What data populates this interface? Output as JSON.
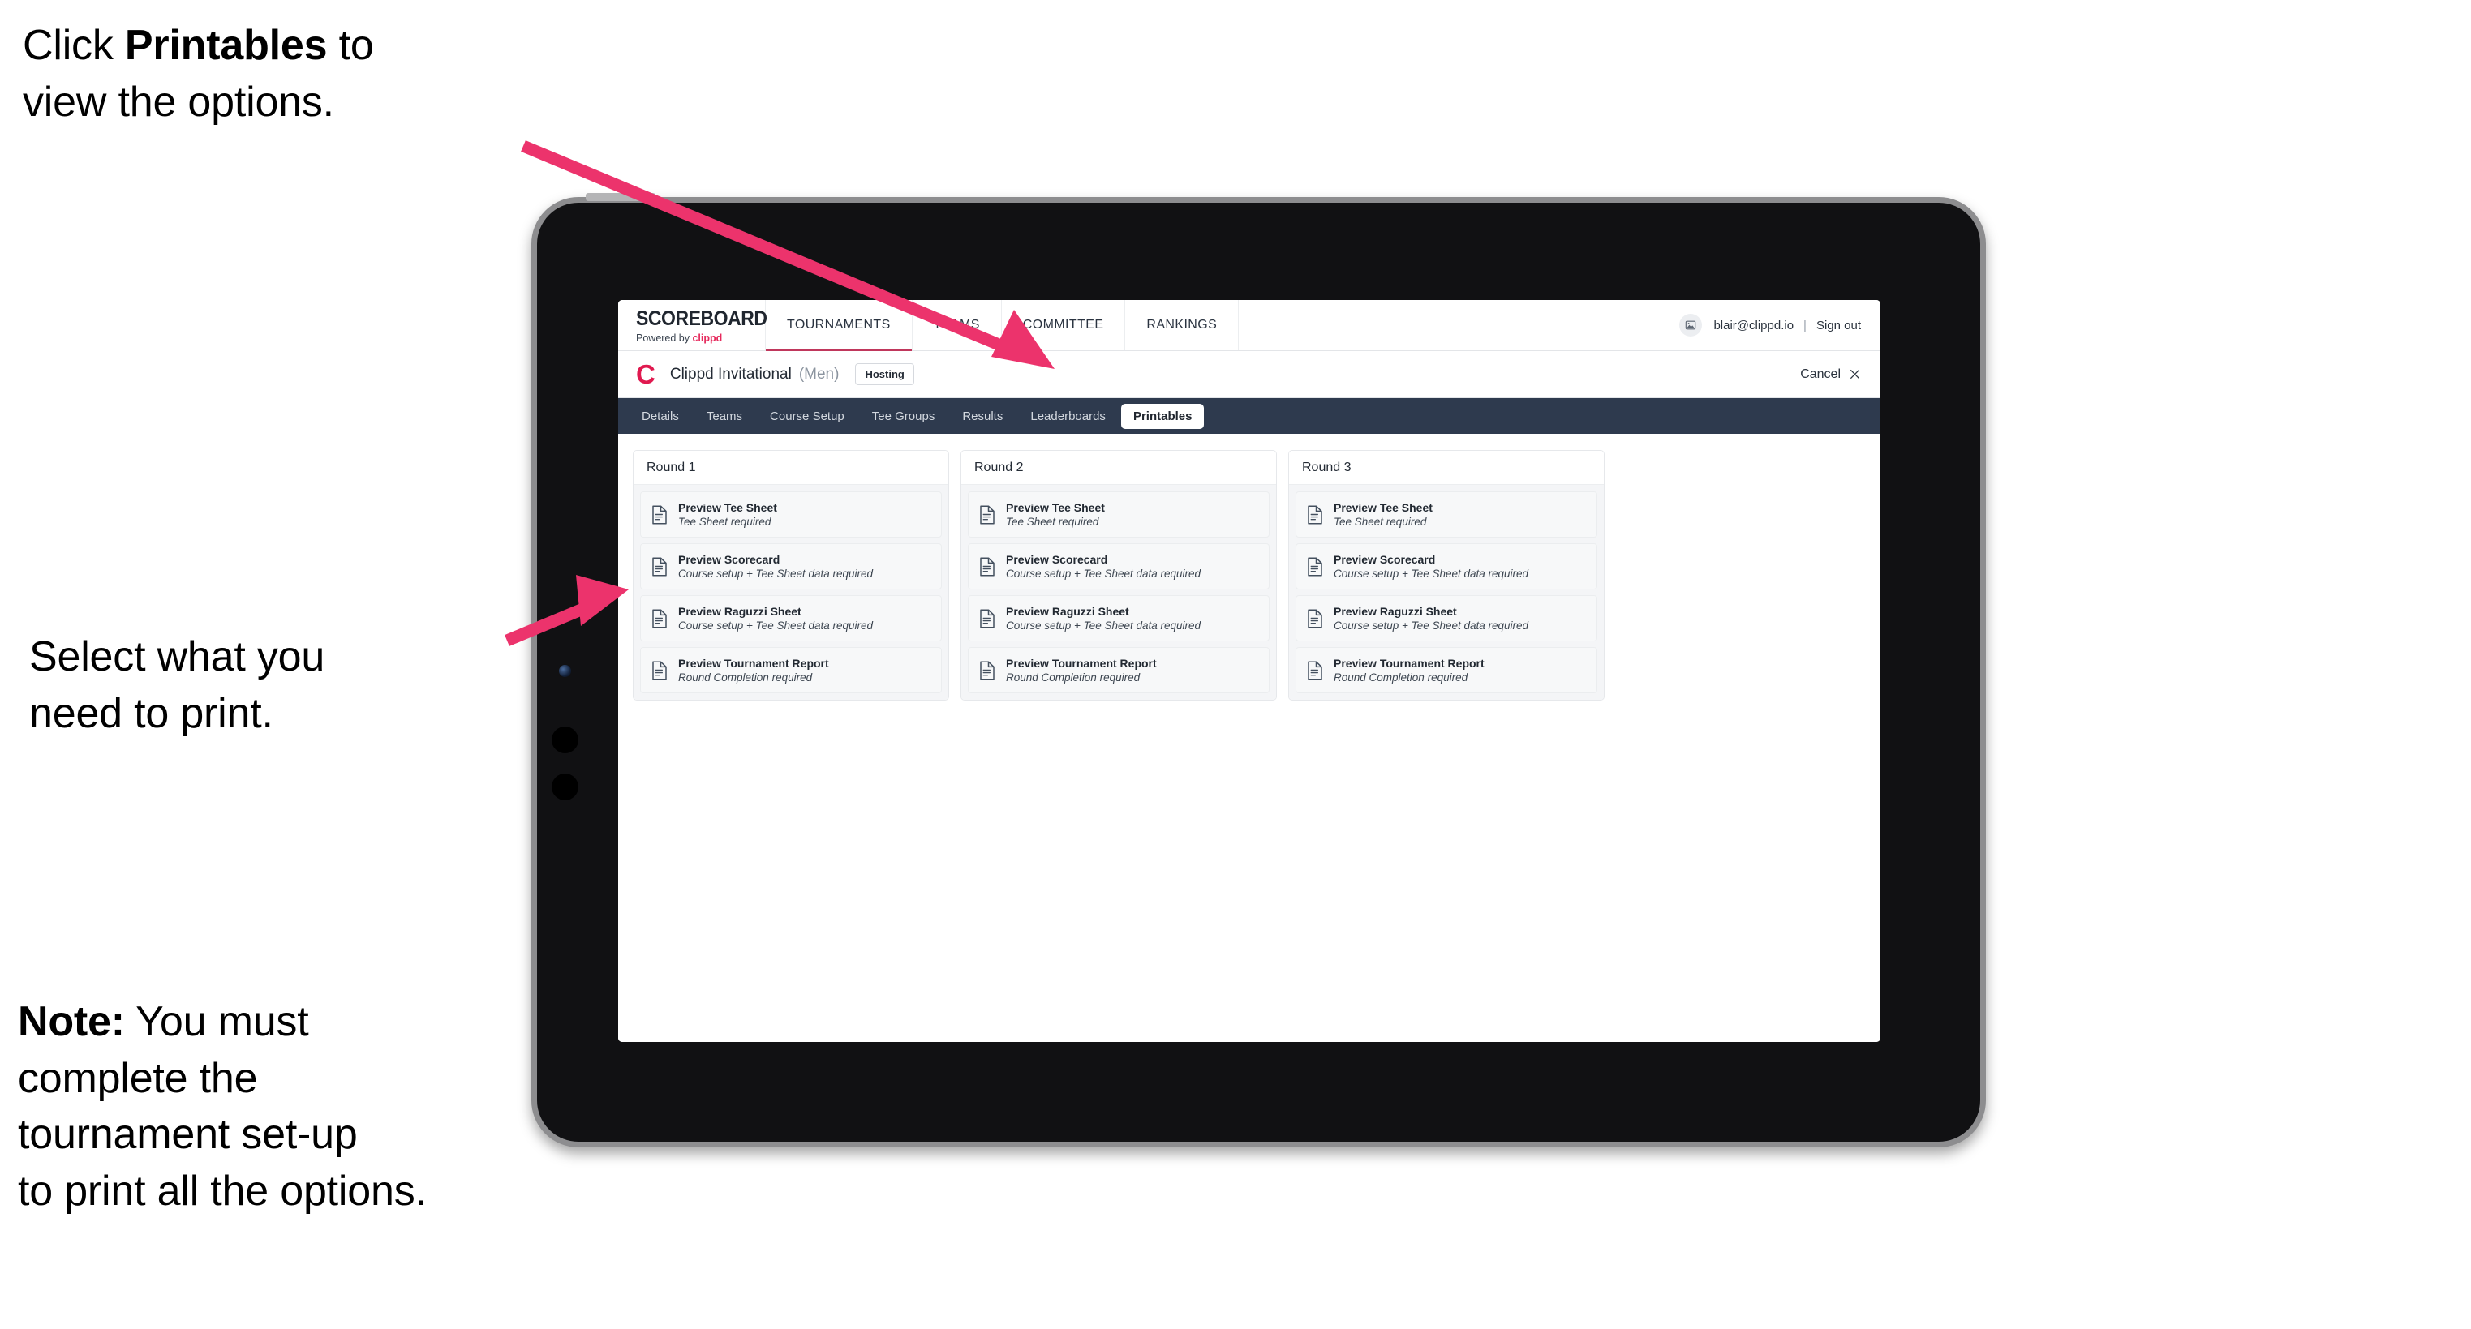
{
  "annotations": {
    "click_printables": "Click ",
    "click_printables_bold": "Printables",
    "click_printables_tail": " to\nview the options.",
    "select_print": "Select what you\n need to print.",
    "note_label": "Note:",
    "note_body": " You must\ncomplete the\ntournament set-up\nto print all the options."
  },
  "colors": {
    "accent_pink": "#e6295c",
    "arrow_pink": "#ec336c",
    "tabstrip_dark": "#2e3a4e",
    "nav_underline": "#c0375c"
  },
  "app": {
    "brand": {
      "name": "SCOREBOARD",
      "powered_prefix": "Powered by ",
      "powered_brand": "clippd"
    },
    "mainnav": [
      {
        "label": "TOURNAMENTS",
        "active": true
      },
      {
        "label": "TEAMS",
        "active": false
      },
      {
        "label": "COMMITTEE",
        "active": false
      },
      {
        "label": "RANKINGS",
        "active": false
      }
    ],
    "user": {
      "email": "blair@clippd.io",
      "separator": "|",
      "signout": "Sign out",
      "avatar_icon": "image-placeholder-icon"
    },
    "tournament": {
      "logo_letter": "C",
      "name": "Clippd Invitational",
      "gender": "(Men)",
      "badge": "Hosting",
      "cancel_label": "Cancel",
      "cancel_icon": "close-icon"
    },
    "tabs": [
      {
        "label": "Details",
        "active": false
      },
      {
        "label": "Teams",
        "active": false
      },
      {
        "label": "Course Setup",
        "active": false
      },
      {
        "label": "Tee Groups",
        "active": false
      },
      {
        "label": "Results",
        "active": false
      },
      {
        "label": "Leaderboards",
        "active": false
      },
      {
        "label": "Printables",
        "active": true
      }
    ],
    "rounds": [
      {
        "title": "Round 1",
        "items": [
          {
            "title": "Preview Tee Sheet",
            "sub": "Tee Sheet required",
            "icon": "document-icon"
          },
          {
            "title": "Preview Scorecard",
            "sub": "Course setup + Tee Sheet data required",
            "icon": "document-icon"
          },
          {
            "title": "Preview Raguzzi Sheet",
            "sub": "Course setup + Tee Sheet data required",
            "icon": "document-icon"
          },
          {
            "title": "Preview Tournament Report",
            "sub": "Round Completion required",
            "icon": "document-icon"
          }
        ]
      },
      {
        "title": "Round 2",
        "items": [
          {
            "title": "Preview Tee Sheet",
            "sub": "Tee Sheet required",
            "icon": "document-icon"
          },
          {
            "title": "Preview Scorecard",
            "sub": "Course setup + Tee Sheet data required",
            "icon": "document-icon"
          },
          {
            "title": "Preview Raguzzi Sheet",
            "sub": "Course setup + Tee Sheet data required",
            "icon": "document-icon"
          },
          {
            "title": "Preview Tournament Report",
            "sub": "Round Completion required",
            "icon": "document-icon"
          }
        ]
      },
      {
        "title": "Round 3",
        "items": [
          {
            "title": "Preview Tee Sheet",
            "sub": "Tee Sheet required",
            "icon": "document-icon"
          },
          {
            "title": "Preview Scorecard",
            "sub": "Course setup + Tee Sheet data required",
            "icon": "document-icon"
          },
          {
            "title": "Preview Raguzzi Sheet",
            "sub": "Course setup + Tee Sheet data required",
            "icon": "document-icon"
          },
          {
            "title": "Preview Tournament Report",
            "sub": "Round Completion required",
            "icon": "document-icon"
          }
        ]
      }
    ]
  }
}
